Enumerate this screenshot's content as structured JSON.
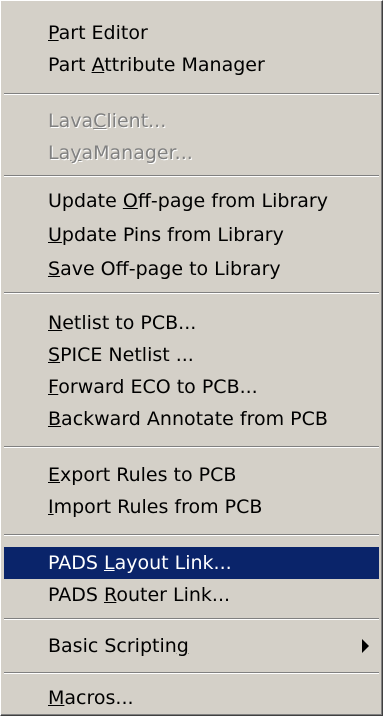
{
  "menu": {
    "items": [
      {
        "pre": "",
        "acc": "P",
        "post": "art Editor"
      },
      {
        "pre": "Part ",
        "acc": "A",
        "post": "ttribute Manager"
      },
      {
        "pre": "Lava",
        "acc": "C",
        "post": "lient..."
      },
      {
        "pre": "La",
        "acc": "y",
        "post": "aManager..."
      },
      {
        "pre": "Update ",
        "acc": "O",
        "post": "ff-page from Library"
      },
      {
        "pre": "",
        "acc": "U",
        "post": "pdate Pins from Library"
      },
      {
        "pre": "",
        "acc": "S",
        "post": "ave Off-page to Library"
      },
      {
        "pre": "",
        "acc": "N",
        "post": "etlist to PCB..."
      },
      {
        "pre": "",
        "acc": "S",
        "post": "PICE Netlist ..."
      },
      {
        "pre": "",
        "acc": "F",
        "post": "orward ECO to PCB..."
      },
      {
        "pre": "",
        "acc": "B",
        "post": "ackward Annotate from PCB"
      },
      {
        "pre": "",
        "acc": "E",
        "post": "xport Rules to PCB"
      },
      {
        "pre": "",
        "acc": "I",
        "post": "mport Rules from PCB"
      },
      {
        "pre": "PADS ",
        "acc": "L",
        "post": "ayout Link..."
      },
      {
        "pre": "PADS ",
        "acc": "R",
        "post": "outer Link..."
      },
      {
        "pre": "Basic Scriptin",
        "acc": "g",
        "post": ""
      },
      {
        "pre": "",
        "acc": "M",
        "post": "acros..."
      }
    ],
    "states": {
      "disabled_items": [
        "LavaClient...",
        "LayaManager..."
      ],
      "highlighted_item": "PADS Layout Link...",
      "submenu_item": "Basic Scripting"
    },
    "icons": {
      "submenu": "submenu-arrow-icon"
    },
    "colors": {
      "menu_background": "#d4d0c8",
      "highlight_background": "#0a246a",
      "highlight_text": "#ffffff",
      "disabled_text": "#808080",
      "text": "#000000"
    }
  }
}
